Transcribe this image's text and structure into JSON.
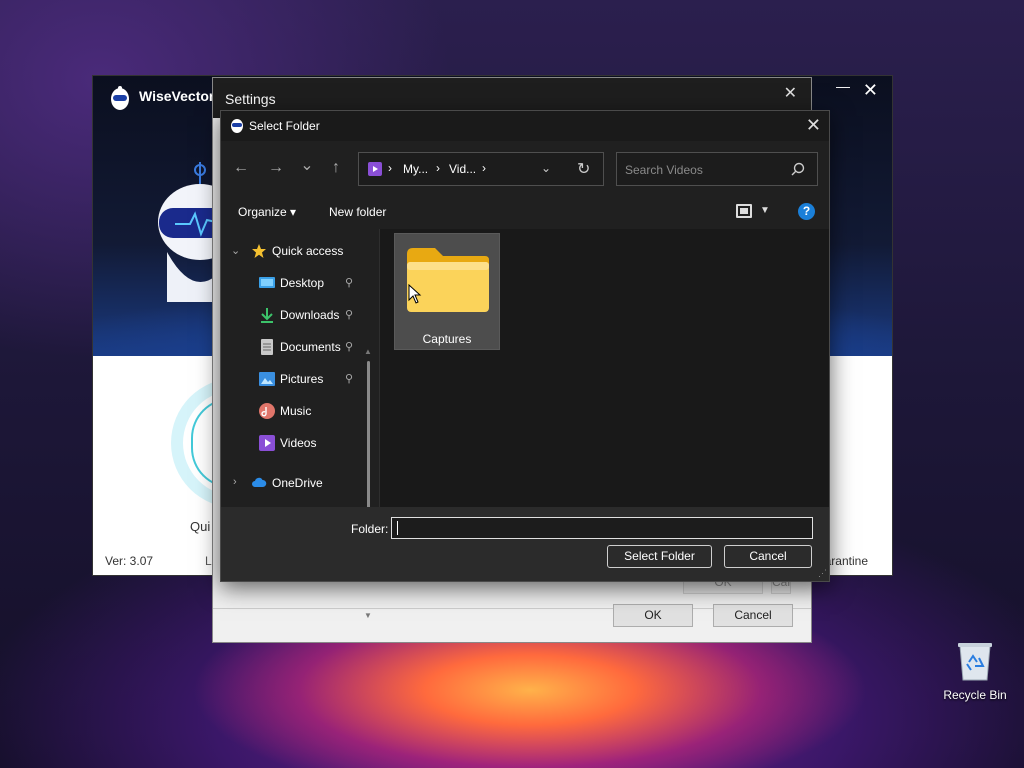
{
  "background_app": {
    "title": "WiseVector",
    "version": "Ver: 3.07",
    "partial_left_label": "L",
    "partial_quick_label": "Qui",
    "partial_right_label": "arantine",
    "close_glyph": "✕",
    "min_glyph": "—"
  },
  "settings_window": {
    "title": "Settings",
    "close_glyph": "✕",
    "ok_label": "OK",
    "cancel_label": "Cancel",
    "ghost_ok_label": "OK",
    "ghost_cancel_label": "Cancel"
  },
  "dialog": {
    "title": "Select Folder",
    "close_glyph": "✕",
    "nav": {
      "back_glyph": "←",
      "forward_glyph": "→",
      "recent_glyph": "⌄",
      "up_glyph": "↑"
    },
    "address": {
      "crumbs": [
        "My...",
        "Vid..."
      ],
      "separator": "›",
      "dropdown_glyph": "⌄",
      "refresh_glyph": "↻"
    },
    "search": {
      "placeholder": "Search Videos"
    },
    "toolbar": {
      "organize_label": "Organize ▾",
      "new_folder_label": "New folder",
      "view_dropdown_glyph": "▼",
      "help_glyph": "?"
    },
    "nav_pane": {
      "quick_access": "Quick access",
      "items": [
        {
          "label": "Desktop",
          "icon": "desktop-icon",
          "pinned": true
        },
        {
          "label": "Downloads",
          "icon": "downloads-icon",
          "pinned": true
        },
        {
          "label": "Documents",
          "icon": "documents-icon",
          "pinned": true
        },
        {
          "label": "Pictures",
          "icon": "pictures-icon",
          "pinned": true
        },
        {
          "label": "Music",
          "icon": "music-icon",
          "pinned": false
        },
        {
          "label": "Videos",
          "icon": "videos-icon",
          "pinned": false
        }
      ],
      "onedrive": "OneDrive",
      "pin_glyph": "📌",
      "expanded_glyph": "⌄",
      "collapsed_glyph": "›"
    },
    "content": {
      "folders": [
        {
          "name": "Captures"
        }
      ]
    },
    "footer": {
      "folder_label": "Folder:",
      "folder_value": "",
      "select_label": "Select Folder",
      "cancel_label": "Cancel"
    }
  },
  "desktop": {
    "recycle_bin_label": "Recycle Bin"
  },
  "colors": {
    "accent_blue": "#1a7fd8",
    "folder_yellow": "#f7c948",
    "dialog_bg": "#202020"
  }
}
